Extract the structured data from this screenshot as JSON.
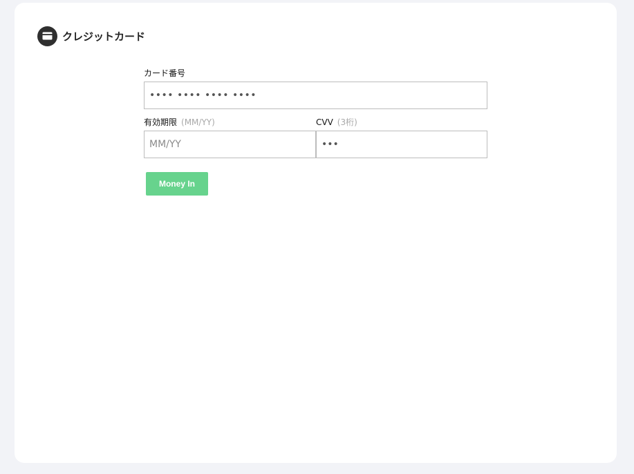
{
  "header": {
    "title": "クレジットカード",
    "icon": "credit-card-icon"
  },
  "form": {
    "card_number": {
      "label": "カード番号",
      "value": "•••• •••• •••• ••••"
    },
    "expiry": {
      "label": "有効期限",
      "hint": "(MM/YY)",
      "placeholder": "MM/YY"
    },
    "cvv": {
      "label": "CVV",
      "hint": "(3桁)",
      "value": "•••"
    },
    "submit_label": "Money In"
  },
  "colors": {
    "page_background": "#f2f3f7",
    "card_background": "#ffffff",
    "button": "#67d38d",
    "icon_circle": "#2f2f2f",
    "input_border": "#bcbcbc"
  }
}
